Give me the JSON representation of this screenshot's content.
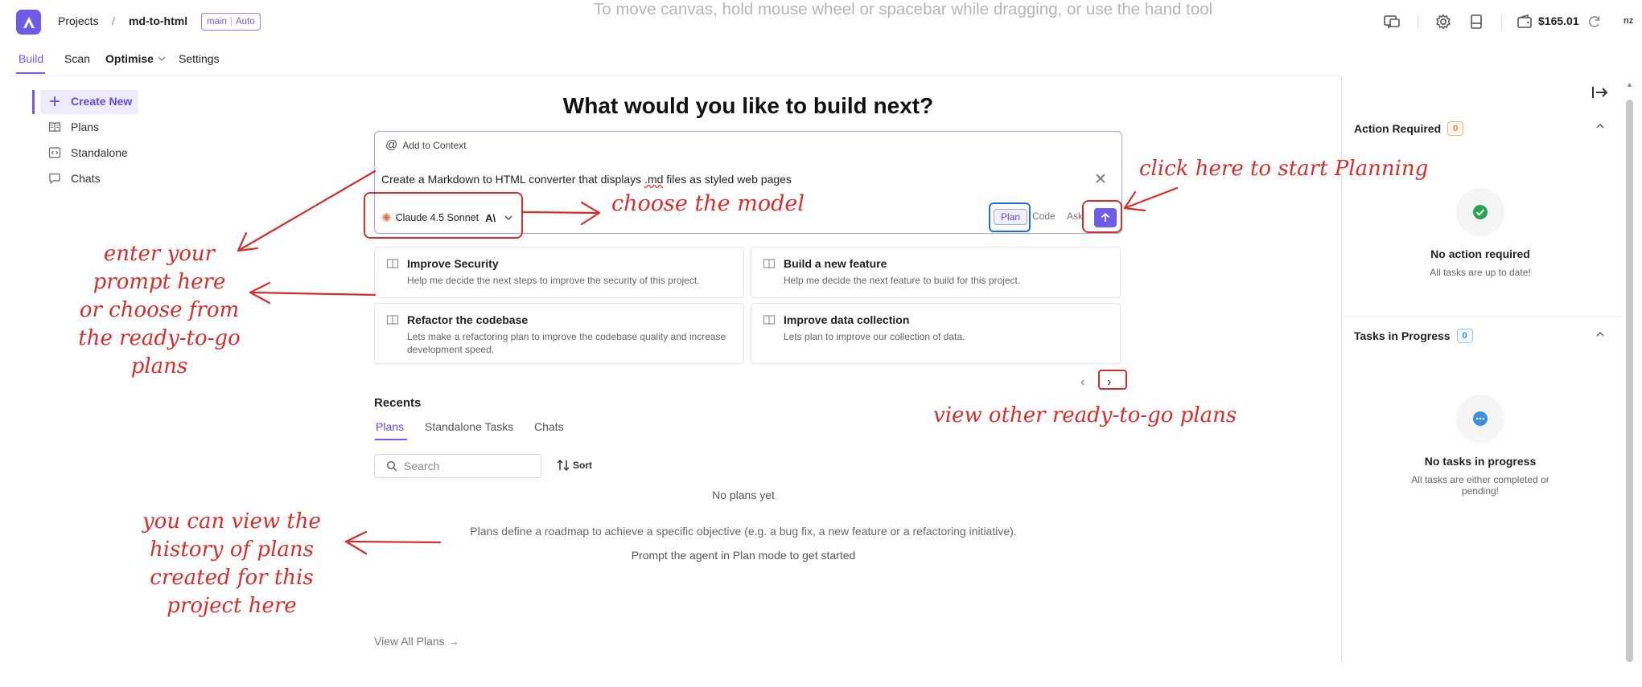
{
  "header": {
    "breadcrumb_root": "Projects",
    "breadcrumb_separator": "/",
    "project_name": "md-to-html",
    "branch": "main",
    "branch_mode": "Auto",
    "canvas_hint": "To move canvas, hold mouse wheel or spacebar while dragging, or use the hand tool",
    "credit": "$165.01",
    "user_initials": "nz",
    "icons": [
      "chat-window-icon",
      "gear-icon",
      "document-icon",
      "wallet-icon",
      "refresh-icon"
    ]
  },
  "tabs": [
    "Build",
    "Scan",
    "Optimise",
    "Settings"
  ],
  "active_tab": "Build",
  "sidebar": {
    "items": [
      {
        "label": "Create New",
        "icon": "plus-icon"
      },
      {
        "label": "Plans",
        "icon": "book-icon"
      },
      {
        "label": "Standalone",
        "icon": "code-box-icon"
      },
      {
        "label": "Chats",
        "icon": "chat-bubble-icon"
      }
    ]
  },
  "main": {
    "headline": "What would you like to build next?",
    "add_context": "Add to Context",
    "prompt_value": "Create a Markdown to HTML converter that displays .md files as styled web pages",
    "prompt_pre": "Create a Markdown to HTML converter that displays ",
    "prompt_squiggle": ".md",
    "prompt_post": " files as styled web pages",
    "model": "Claude 4.5 Sonnet",
    "modes": [
      "Plan",
      "Code",
      "Ask"
    ],
    "active_mode": "Plan",
    "cards": [
      {
        "title": "Improve Security",
        "desc": "Help me decide the next steps to improve the security of this project."
      },
      {
        "title": "Build a new feature",
        "desc": "Help me decide the next feature to build for this project."
      },
      {
        "title": "Refactor the codebase",
        "desc": "Lets make a refactoring plan to improve the codebase quality and increase development speed."
      },
      {
        "title": "Improve data collection",
        "desc": "Lets plan to improve our collection of data."
      }
    ],
    "pager_prev": "‹",
    "pager_next": "›",
    "recents": {
      "title": "Recents",
      "tabs": [
        "Plans",
        "Standalone Tasks",
        "Chats"
      ],
      "active_tab": "Plans",
      "search_placeholder": "Search",
      "sort_label": "Sort",
      "empty_title": "No plans yet",
      "empty_desc": "Plans define a roadmap to achieve a specific objective (e.g. a bug fix, a new feature or a refactoring initiative).",
      "empty_desc2": "Prompt the agent in Plan mode to get started",
      "view_all": "View All Plans →"
    }
  },
  "right_panel": {
    "action_required": {
      "title": "Action Required",
      "count": "0",
      "status_title": "No action required",
      "status_sub": "All tasks are up to date!"
    },
    "tasks_in_progress": {
      "title": "Tasks in Progress",
      "count": "0",
      "status_title": "No tasks in progress",
      "status_sub": "All tasks are either completed or pending!"
    }
  },
  "annotations": {
    "prompt": [
      "enter your",
      "prompt here",
      "or choose from",
      "the ready-to-go",
      "plans"
    ],
    "model": "choose the model",
    "planning": "click here to start Planning",
    "other_plans": "view other ready-to-go plans",
    "history": [
      "you can view the",
      "history of plans",
      "created for this",
      "project here"
    ]
  },
  "colors": {
    "accent": "#6d5ce8",
    "annotation_red": "#d32f2f",
    "annotation_blue": "#1e6fd9",
    "success_green": "#22a94f",
    "info_blue": "#3a8ee6",
    "warning_orange": "#e6843a"
  }
}
